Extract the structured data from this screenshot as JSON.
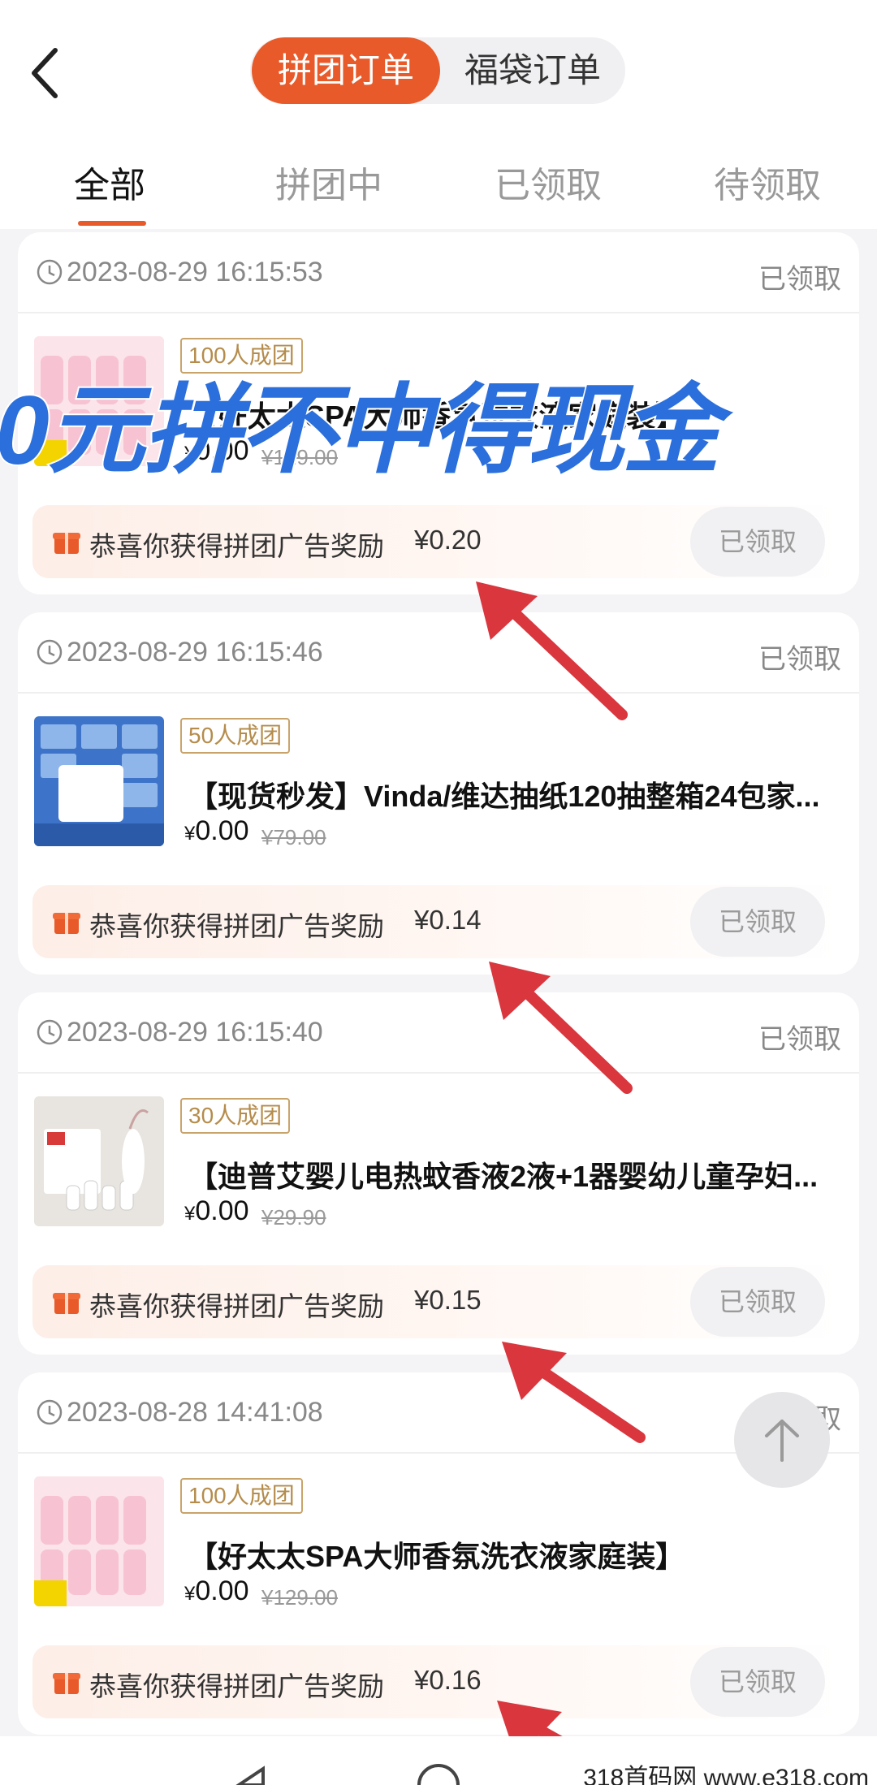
{
  "header": {
    "segments": [
      "拼团订单",
      "福袋订单"
    ],
    "active_segment": 0
  },
  "tabs": [
    "全部",
    "拼团中",
    "已领取",
    "待领取"
  ],
  "active_tab": 0,
  "orders": [
    {
      "time": "2023-08-29 16:15:53",
      "status": "已领取",
      "group_tag": "100人成团",
      "title": "【好太太SPA大师香氛洗衣液家庭装】",
      "price": "0.00",
      "original_price": "¥129.00",
      "reward_text": "恭喜你获得拼团广告奖励",
      "reward_amount": "¥0.20",
      "button": "已领取"
    },
    {
      "time": "2023-08-29 16:15:46",
      "status": "已领取",
      "group_tag": "50人成团",
      "title": "【现货秒发】Vinda/维达抽纸120抽整箱24包家...",
      "price": "0.00",
      "original_price": "¥79.00",
      "reward_text": "恭喜你获得拼团广告奖励",
      "reward_amount": "¥0.14",
      "button": "已领取"
    },
    {
      "time": "2023-08-29 16:15:40",
      "status": "已领取",
      "group_tag": "30人成团",
      "title": "【迪普艾婴儿电热蚊香液2液+1器婴幼儿童孕妇...",
      "price": "0.00",
      "original_price": "¥29.90",
      "reward_text": "恭喜你获得拼团广告奖励",
      "reward_amount": "¥0.15",
      "button": "已领取"
    },
    {
      "time": "2023-08-28 14:41:08",
      "status": "已领取",
      "group_tag": "100人成团",
      "title": "【好太太SPA大师香氛洗衣液家庭装】",
      "price": "0.00",
      "original_price": "¥129.00",
      "reward_text": "恭喜你获得拼团广告奖励",
      "reward_amount": "¥0.16",
      "button": "已领取"
    }
  ],
  "currency_symbol": "¥",
  "overlay_text": "0元拼不中得现金",
  "watermark": "318首码网  www.e318.com",
  "colors": {
    "accent": "#e85a2a",
    "overlay_blue": "#2b6fdc",
    "arrow_red": "#d9363e",
    "tag_gold": "#b58c4b"
  },
  "icons": [
    "back-arrow-icon",
    "clock-icon",
    "gift-icon",
    "arrow-up-icon",
    "nav-back-icon",
    "nav-home-icon"
  ]
}
